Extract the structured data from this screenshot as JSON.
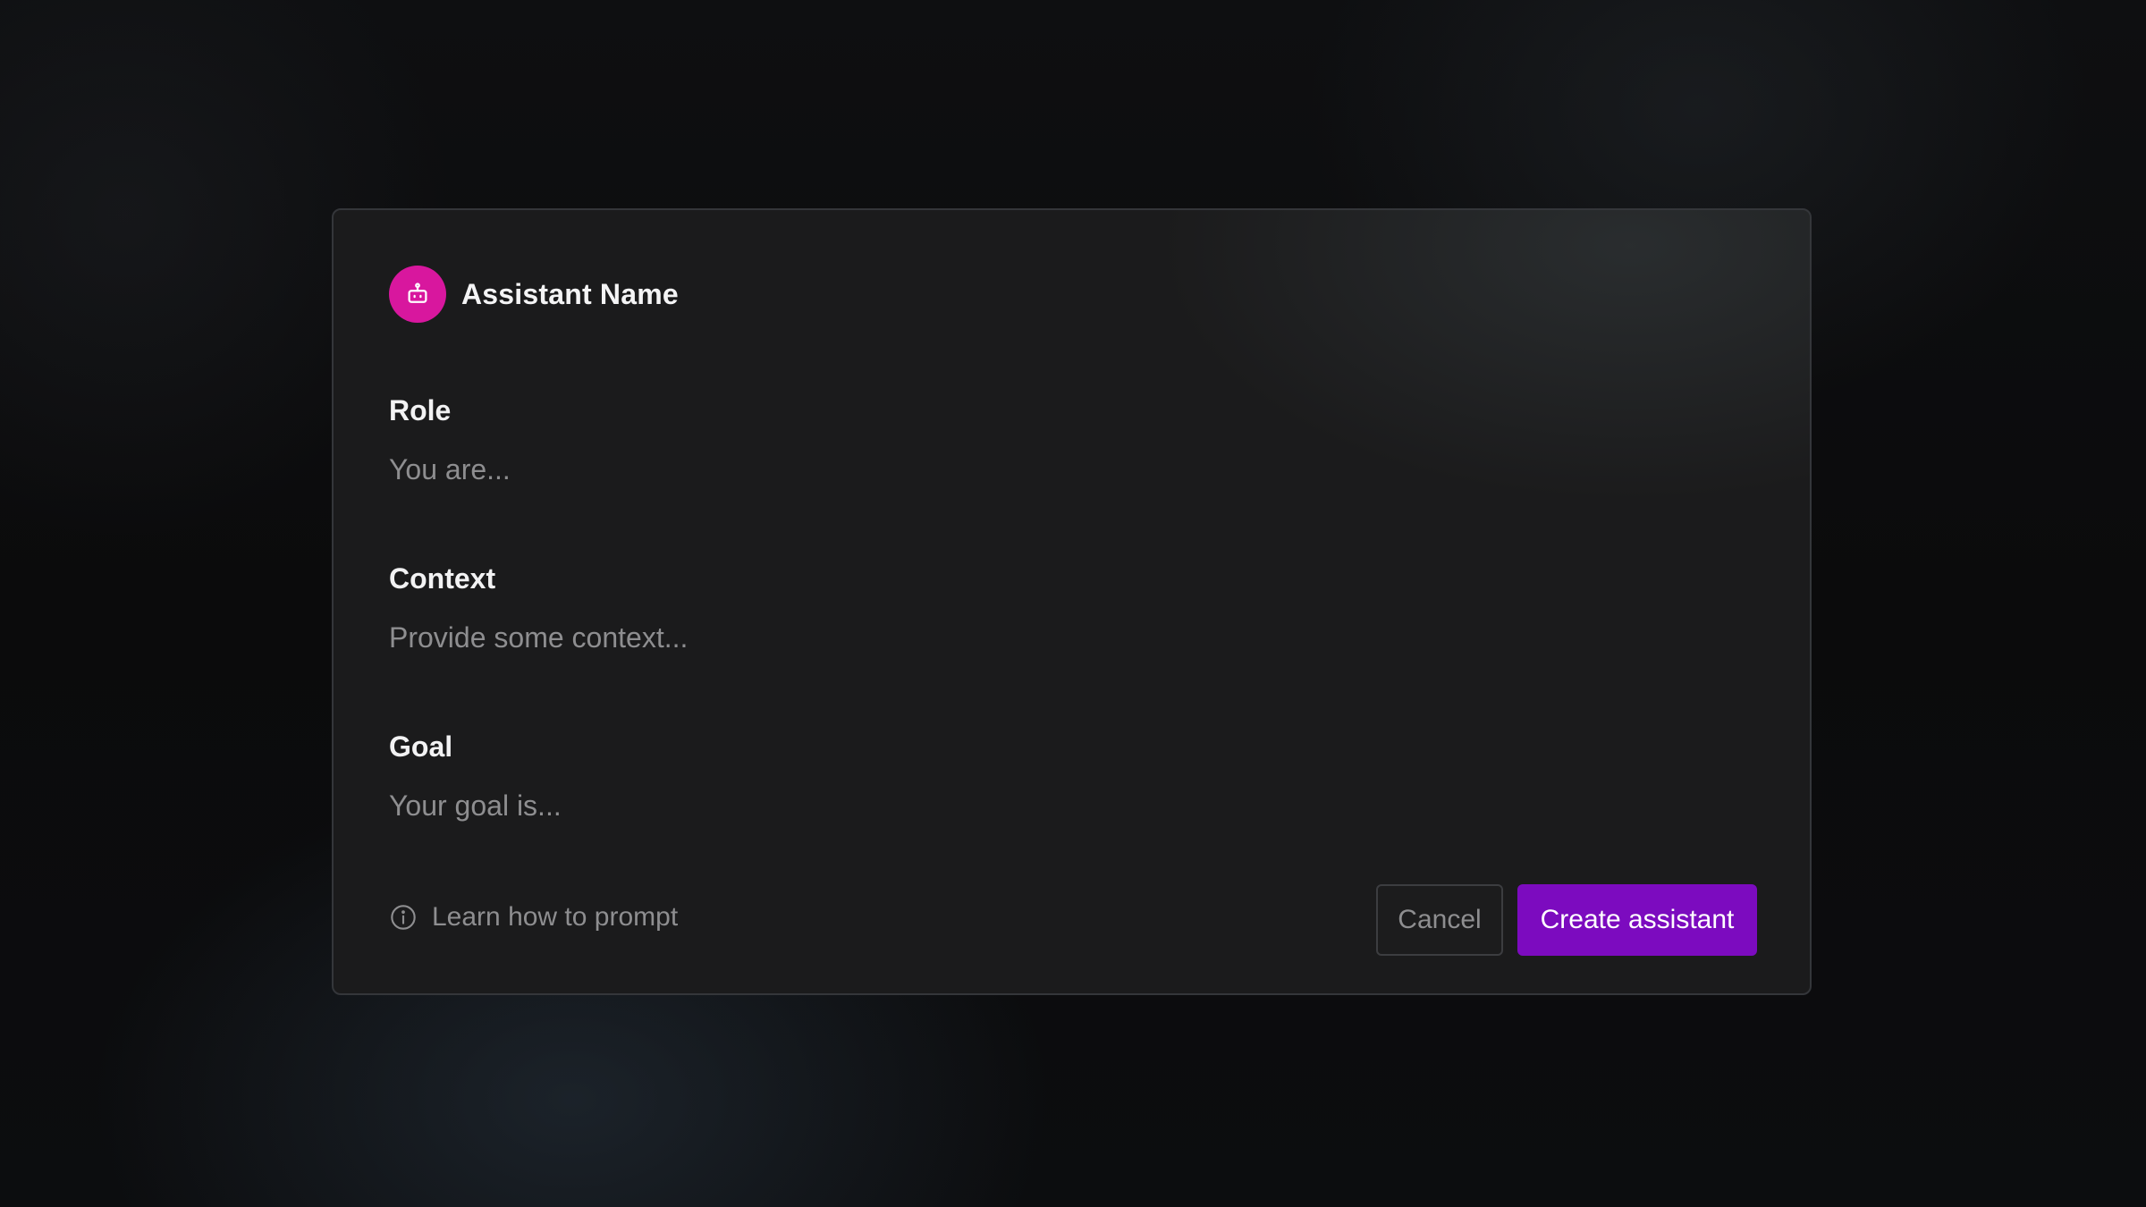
{
  "assistant": {
    "name": "Assistant Name",
    "icon": "robot-icon",
    "icon_color": "#d8179e"
  },
  "fields": {
    "role": {
      "label": "Role",
      "placeholder": "You are..."
    },
    "context": {
      "label": "Context",
      "placeholder": "Provide some context..."
    },
    "goal": {
      "label": "Goal",
      "placeholder": "Your goal is..."
    }
  },
  "footer": {
    "help_icon": "info-circle-icon",
    "help_link": "Learn how to prompt",
    "cancel_label": "Cancel",
    "create_label": "Create assistant"
  },
  "colors": {
    "accent": "#7c0bbf",
    "background": "#1b1b1c"
  }
}
